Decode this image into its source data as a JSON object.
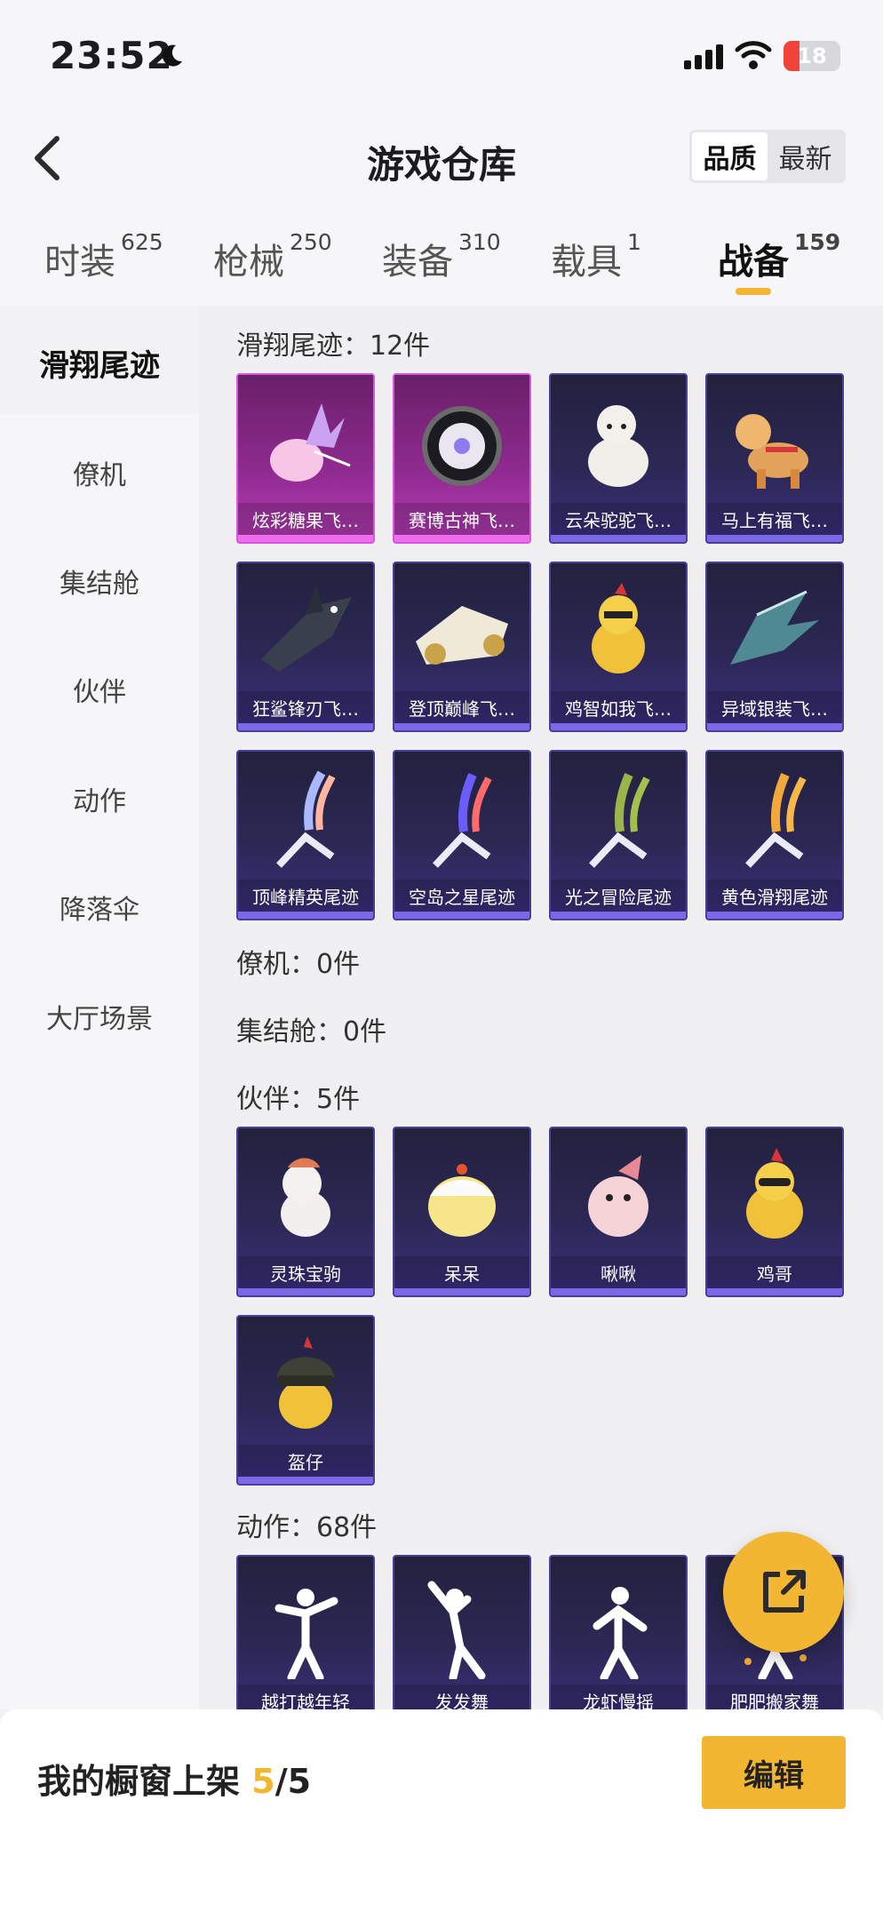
{
  "status_bar": {
    "time": "23:52",
    "battery": "18"
  },
  "header": {
    "title": "游戏仓库",
    "sort_options": [
      "品质",
      "最新"
    ],
    "active_sort": "品质"
  },
  "tabs": [
    {
      "label": "时装",
      "count": "625"
    },
    {
      "label": "枪械",
      "count": "250"
    },
    {
      "label": "装备",
      "count": "310"
    },
    {
      "label": "载具",
      "count": "1"
    },
    {
      "label": "战备",
      "count": "159",
      "active": true
    }
  ],
  "sidebar": {
    "items": [
      "滑翔尾迹",
      "僚机",
      "集结舱",
      "伙伴",
      "动作",
      "降落伞",
      "大厅场景"
    ],
    "active": "滑翔尾迹"
  },
  "sections": {
    "glide_trails": {
      "title": "滑翔尾迹：12件",
      "items": [
        "炫彩糖果飞…",
        "赛博古神飞…",
        "云朵驼驼飞…",
        "马上有福飞…",
        "狂鲨锋刃飞…",
        "登顶巅峰飞…",
        "鸡智如我飞…",
        "异域银装飞…",
        "顶峰精英尾迹",
        "空岛之星尾迹",
        "光之冒险尾迹",
        "黄色滑翔尾迹"
      ]
    },
    "wingman": {
      "title": "僚机：0件"
    },
    "capsule": {
      "title": "集结舱：0件"
    },
    "partners": {
      "title": "伙伴：5件",
      "items": [
        "灵珠宝驹",
        "呆呆",
        "啾啾",
        "鸡哥",
        "盔仔"
      ]
    },
    "emotes": {
      "title": "动作：68件",
      "items": [
        "越打越年轻",
        "发发舞",
        "龙虾慢摇",
        "肥肥搬家舞"
      ]
    }
  },
  "bottom_bar": {
    "label": "我的橱窗上架 ",
    "current": "5",
    "total": "/5",
    "edit_label": "编辑"
  }
}
